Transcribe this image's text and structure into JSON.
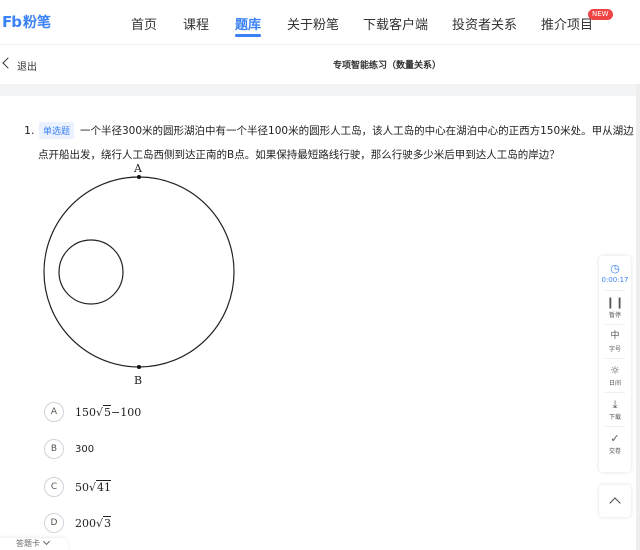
{
  "brand": {
    "mark": "Fb",
    "name": "粉笔",
    "color": "#3b82f6"
  },
  "nav": {
    "items": [
      {
        "label": "首页"
      },
      {
        "label": "课程"
      },
      {
        "label": "题库"
      },
      {
        "label": "关于粉笔"
      },
      {
        "label": "下载客户端"
      },
      {
        "label": "投资者关系"
      },
      {
        "label": "推介项目"
      }
    ],
    "active": "题库",
    "new_badge": "NEW"
  },
  "subheader": {
    "back_label": "退出",
    "title": "专项智能练习（数量关系）"
  },
  "question": {
    "number": "1.",
    "type_tag": "单选题",
    "line1": "一个半径300米的圆形湖泊中有一个半径100米的圆形人工岛，该人工岛的中心在湖泊中心的正西方150米处。甲从湖边",
    "line2": "点开船出发，绕行人工岛西侧到达正南的B点。如果保持最短路线行驶，那么行驶多少米后甲到达人工岛的岸边？",
    "figure": {
      "top_label": "A",
      "bottom_label": "B"
    }
  },
  "options": [
    {
      "letter": "A",
      "pre": "150",
      "rad": "5",
      "post": "−100"
    },
    {
      "letter": "B",
      "pre": "300",
      "rad": "",
      "post": ""
    },
    {
      "letter": "C",
      "pre": "50",
      "rad": "41",
      "post": ""
    },
    {
      "letter": "D",
      "pre": "200",
      "rad": "3",
      "post": ""
    }
  ],
  "tools": {
    "timer": "0:00:17",
    "pause": "暂停",
    "font": "字号",
    "day": "日间",
    "download": "下载",
    "submit": "交卷",
    "font_glyph": "中"
  },
  "answer_sheet": "答题卡"
}
